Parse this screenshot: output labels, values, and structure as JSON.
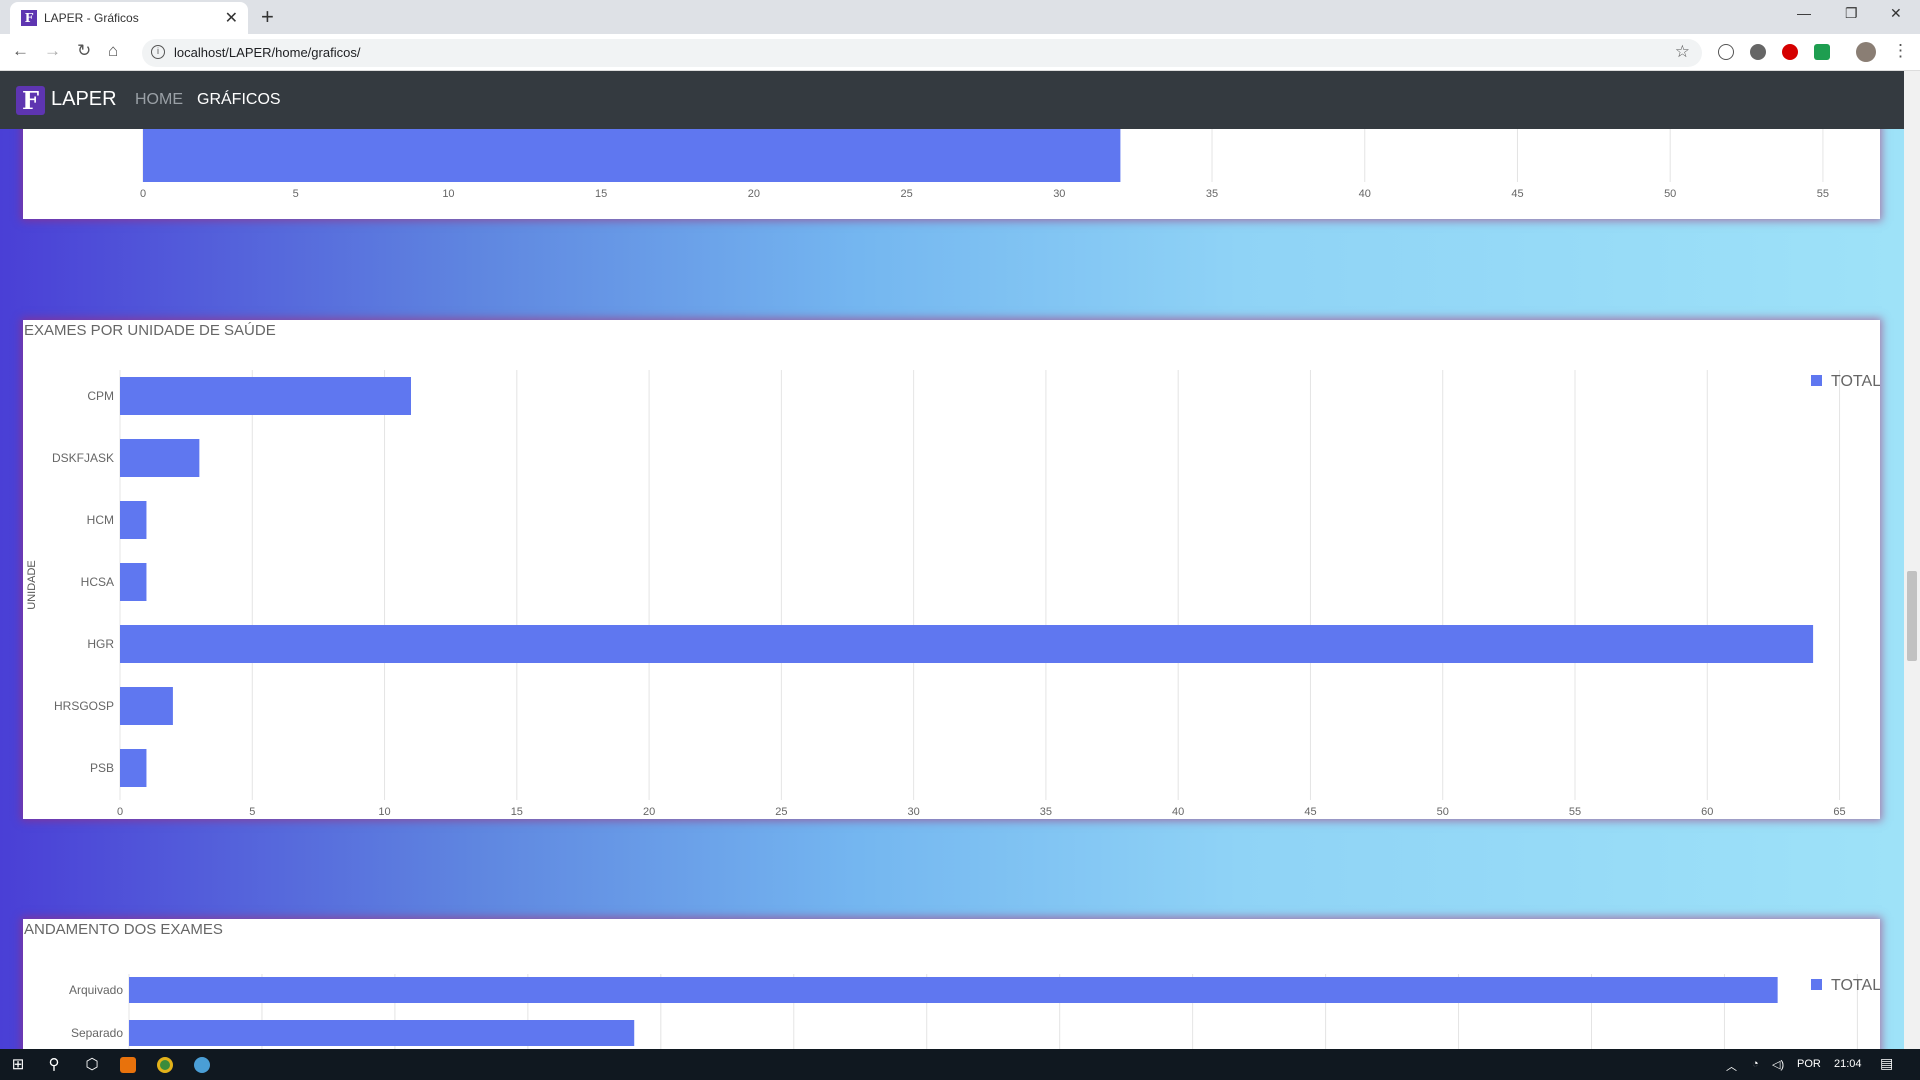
{
  "browser": {
    "tab_title": "LAPER - Gráficos",
    "tab_close": "✕",
    "new_tab": "+",
    "url": "localhost/LAPER/home/graficos/",
    "win_minimize": "—",
    "win_restore": "❐",
    "win_close": "✕"
  },
  "navbar": {
    "logo": "F",
    "brand": "LAPER",
    "links": [
      {
        "label": "Home",
        "active": false
      },
      {
        "label": "Gráficos",
        "active": true
      }
    ]
  },
  "colors": {
    "bar": "#5f77f0",
    "navbar": "#343a40",
    "card_glow": "#aa286e"
  },
  "chart_data": [
    {
      "type": "bar",
      "orientation": "horizontal",
      "title": "",
      "xlim": [
        0,
        57
      ],
      "xticks": [
        0,
        5,
        10,
        15,
        20,
        25,
        30,
        35,
        40,
        45,
        50,
        55
      ],
      "categories": [
        ""
      ],
      "values": [
        32
      ],
      "partially_visible": true,
      "grid": true
    },
    {
      "type": "bar",
      "orientation": "horizontal",
      "title": "EXAMES POR UNIDADE DE SAÚDE",
      "ylabel": "UNIDADE",
      "xlabel": "",
      "xlim": [
        0,
        66
      ],
      "xticks": [
        0,
        5,
        10,
        15,
        20,
        25,
        30,
        35,
        40,
        45,
        50,
        55,
        60,
        65
      ],
      "categories": [
        "CPM",
        "DSKFJASK",
        "HCM",
        "HCSA",
        "HGR",
        "HRSGOSP",
        "PSB"
      ],
      "series": [
        {
          "name": "TOTAL",
          "values": [
            11,
            3,
            1,
            1,
            64,
            2,
            1
          ]
        }
      ],
      "legend": "top-right",
      "grid": true
    },
    {
      "type": "bar",
      "orientation": "horizontal",
      "title": "ANDAMENTO DOS EXAMES",
      "categories": [
        "Arquivado",
        "Separado"
      ],
      "series": [
        {
          "name": "TOTAL",
          "values": [
            31,
            9.5
          ]
        }
      ],
      "legend": "top-right",
      "partially_visible": true,
      "grid": true
    }
  ],
  "taskbar": {
    "tray_lang": "POR",
    "tray_time": "21:04"
  }
}
